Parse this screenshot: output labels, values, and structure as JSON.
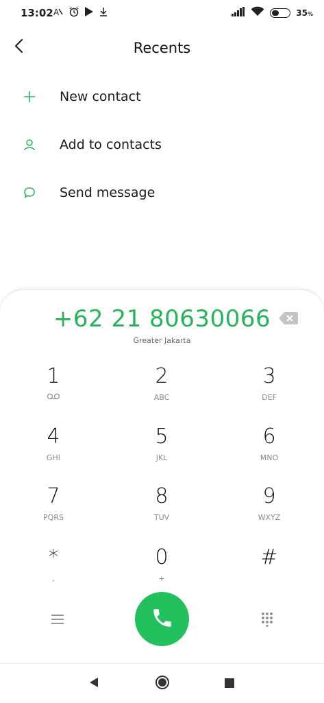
{
  "status_bar": {
    "time": "13:02",
    "battery_percent": "35",
    "battery_unit": "%",
    "battery_level": 0.35,
    "icons_left": [
      "auto-brightness-icon",
      "alarm-icon",
      "play-store-icon",
      "download-icon"
    ],
    "icons_right": [
      "signal-icon",
      "wifi-icon",
      "battery-icon"
    ]
  },
  "header": {
    "title": "Recents",
    "back_icon": "chevron-left-icon"
  },
  "actions": [
    {
      "label": "New contact",
      "icon": "plus-icon"
    },
    {
      "label": "Add to contacts",
      "icon": "person-icon"
    },
    {
      "label": "Send message",
      "icon": "message-bubble-icon"
    }
  ],
  "dialer": {
    "number": "+62 21 80630066",
    "location": "Greater Jakarta",
    "keys": [
      {
        "digit": "1",
        "letters": ""
      },
      {
        "digit": "2",
        "letters": "ABC"
      },
      {
        "digit": "3",
        "letters": "DEF"
      },
      {
        "digit": "4",
        "letters": "GHI"
      },
      {
        "digit": "5",
        "letters": "JKL"
      },
      {
        "digit": "6",
        "letters": "MNO"
      },
      {
        "digit": "7",
        "letters": "PQRS"
      },
      {
        "digit": "8",
        "letters": "TUV"
      },
      {
        "digit": "9",
        "letters": "WXYZ"
      },
      {
        "digit": "*",
        "letters": ","
      },
      {
        "digit": "0",
        "letters": "+"
      },
      {
        "digit": "#",
        "letters": ""
      }
    ]
  },
  "colors": {
    "accent": "#27b35a",
    "call_button": "#22c15e"
  },
  "nav_bar": {
    "icons": [
      "back-triangle-icon",
      "home-circle-icon",
      "recents-square-icon"
    ]
  }
}
